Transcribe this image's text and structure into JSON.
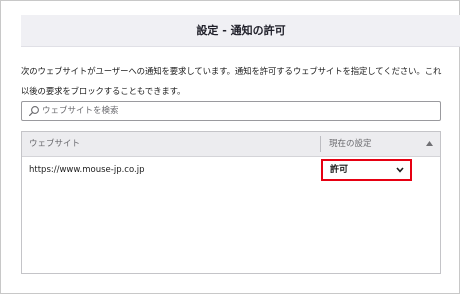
{
  "dialog": {
    "title": "設定 - 通知の許可",
    "description": "次のウェブサイトがユーザーへの通知を要求しています。通知を許可するウェブサイトを指定してください。これ以後の要求をブロックすることもできます。"
  },
  "search": {
    "placeholder": "ウェブサイトを検索",
    "value": "",
    "icon": "search-icon"
  },
  "table": {
    "columns": [
      "ウェブサイト",
      "現在の設定"
    ],
    "sort_icon": "caret-up-icon",
    "rows": [
      {
        "site": "https://www.mouse-jp.co.jp",
        "status": "許可"
      }
    ]
  },
  "colors": {
    "highlight": "#e60012",
    "header_bg": "#f0f0f4"
  }
}
